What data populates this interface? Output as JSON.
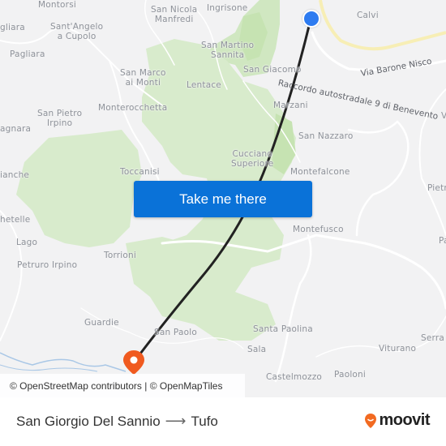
{
  "map": {
    "places": [
      {
        "id": "montorsi",
        "label": "Montorsi"
      },
      {
        "id": "san-nicola-manfredi",
        "label": "San Nicola\nManfredi"
      },
      {
        "id": "ingrisone",
        "label": "Ingrisone"
      },
      {
        "id": "calvi",
        "label": "Calvi"
      },
      {
        "id": "gliara",
        "label": "gliara"
      },
      {
        "id": "santangelo-a-cupolo",
        "label": "Sant'Angelo\na Cupolo"
      },
      {
        "id": "pagliara",
        "label": "Pagliara"
      },
      {
        "id": "san-martino-sannita",
        "label": "San Martino\nSannita"
      },
      {
        "id": "san-giacomo",
        "label": "San Giacomo"
      },
      {
        "id": "san-marco-ai-monti",
        "label": "San Marco\nai Monti"
      },
      {
        "id": "lentace",
        "label": "Lentace"
      },
      {
        "id": "monterocchetta",
        "label": "Monterocchetta"
      },
      {
        "id": "marzani",
        "label": "Marzani"
      },
      {
        "id": "san-pietro-irpino",
        "label": "San Pietro\nIrpino"
      },
      {
        "id": "agnara",
        "label": "agnara"
      },
      {
        "id": "san-nazzaro",
        "label": "San Nazzaro"
      },
      {
        "id": "cucciano-superiore",
        "label": "Cucciano\nSuperiore"
      },
      {
        "id": "toccanisi",
        "label": "Toccanisi"
      },
      {
        "id": "montefalcone",
        "label": "Montefalcone"
      },
      {
        "id": "ianche",
        "label": "ianche"
      },
      {
        "id": "pietr",
        "label": "Pietr"
      },
      {
        "id": "hetelle",
        "label": "hetelle"
      },
      {
        "id": "montefusco",
        "label": "Montefusco"
      },
      {
        "id": "lago",
        "label": "Lago"
      },
      {
        "id": "pa",
        "label": "Pa"
      },
      {
        "id": "petruro-irpino",
        "label": "Petruro Irpino"
      },
      {
        "id": "torrioni",
        "label": "Torrioni"
      },
      {
        "id": "guardie",
        "label": "Guardie"
      },
      {
        "id": "san-paolo",
        "label": "San Paolo"
      },
      {
        "id": "santa-paolina",
        "label": "Santa Paolina"
      },
      {
        "id": "serra",
        "label": "Serra"
      },
      {
        "id": "sala",
        "label": "Sala"
      },
      {
        "id": "viturano",
        "label": "Viturano"
      },
      {
        "id": "castelmozzo",
        "label": "Castelmozzo"
      },
      {
        "id": "paoloni",
        "label": "Paoloni"
      },
      {
        "id": "v",
        "label": "V"
      }
    ],
    "roads": [
      {
        "id": "raccordo",
        "label": "Raccordo autostradale 9 di Benevento"
      },
      {
        "id": "via-barone-nisco",
        "label": "Via Barone Nisco"
      }
    ],
    "colors": {
      "background": "#f2f2f3",
      "forest": "#d8ebcc",
      "forest_dark": "#c6e3b2",
      "road": "#ffffff",
      "highway": "#f7eeb5",
      "river": "#a9c7e6",
      "route": "#222222",
      "origin": "#2d7bf0",
      "destination": "#f05a1f"
    }
  },
  "cta": {
    "label": "Take me there",
    "color": "#0a72d8"
  },
  "attribution": "© OpenStreetMap contributors | © OpenMapTiles",
  "route": {
    "origin": "San Giorgio Del Sannio",
    "arrow": "⟶",
    "destination": "Tufo"
  },
  "brand": {
    "name": "moovit",
    "color": "#f26a21"
  }
}
